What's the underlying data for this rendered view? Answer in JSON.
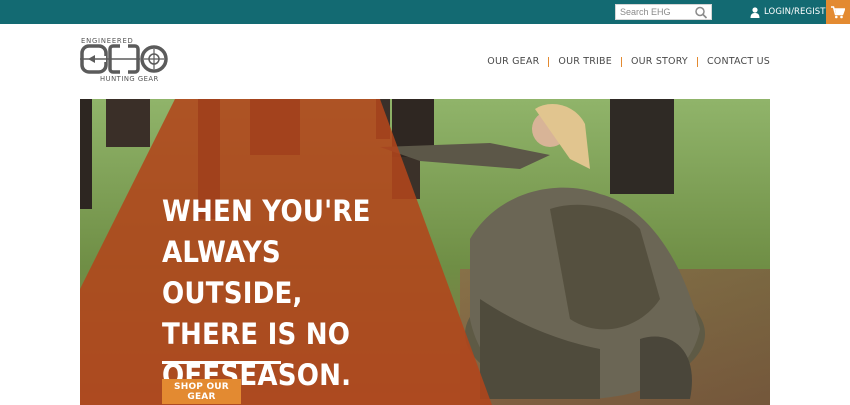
{
  "topbar": {
    "search_placeholder": "Search EHG",
    "login_label": "LOGIN/REGISTER",
    "bg_color": "#136a72",
    "accent_color": "#e38a31"
  },
  "logo": {
    "top_text": "ENGINEERED",
    "bottom_text": "HUNTING GEAR"
  },
  "nav": {
    "items": [
      "OUR GEAR",
      "OUR TRIBE",
      "OUR STORY",
      "CONTACT US"
    ]
  },
  "hero": {
    "headline": "WHEN YOU'RE ALWAYS OUTSIDE, THERE IS NO OFFSEASON.",
    "cta_label": "SHOP OUR GEAR"
  }
}
